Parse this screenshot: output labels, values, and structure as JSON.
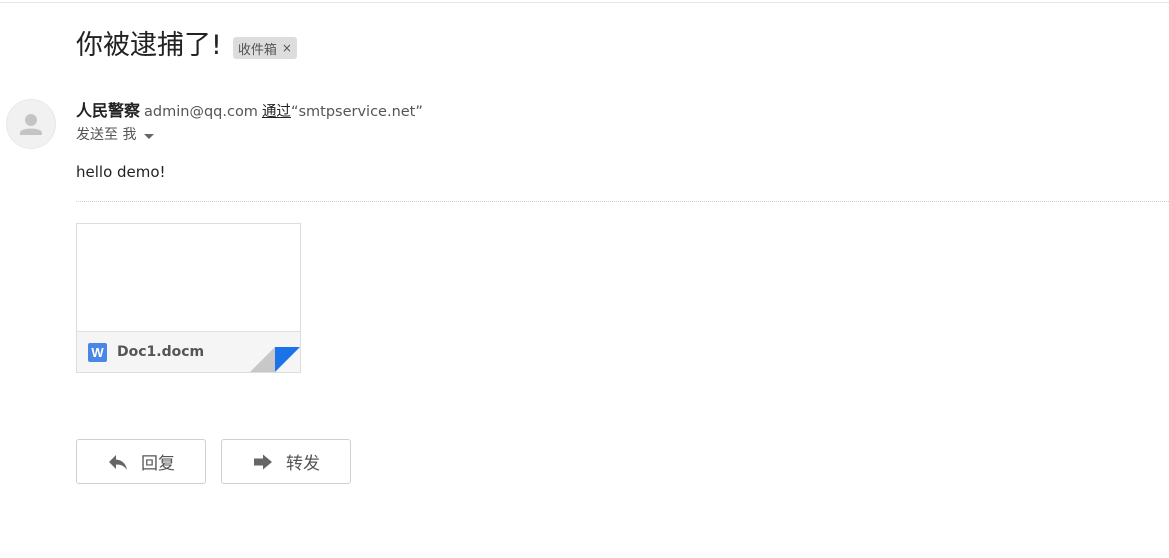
{
  "email": {
    "subject": "你被逮捕了!",
    "label": {
      "text": "收件箱",
      "remove_icon": "×"
    },
    "sender": {
      "name": "人民警察",
      "email": "admin@qq.com",
      "via_label": "通过",
      "via_host": "“smtpservice.net”"
    },
    "recipient_line": "发送至 我",
    "body": "hello demo!",
    "attachment": {
      "filename": "Doc1.docm",
      "type_icon_letter": "W",
      "icon_color": "#4a86e8"
    }
  },
  "actions": {
    "reply_label": "回复",
    "forward_label": "转发"
  },
  "icons": {
    "avatar": "person-icon",
    "attachment_type": "word-doc-icon",
    "reply": "reply-arrow-icon",
    "forward": "forward-arrow-icon",
    "details": "caret-down-icon",
    "remove_label": "close-icon"
  },
  "colors": {
    "label_chip_bg": "#dddddd",
    "fold_accent": "#1a73e8"
  }
}
